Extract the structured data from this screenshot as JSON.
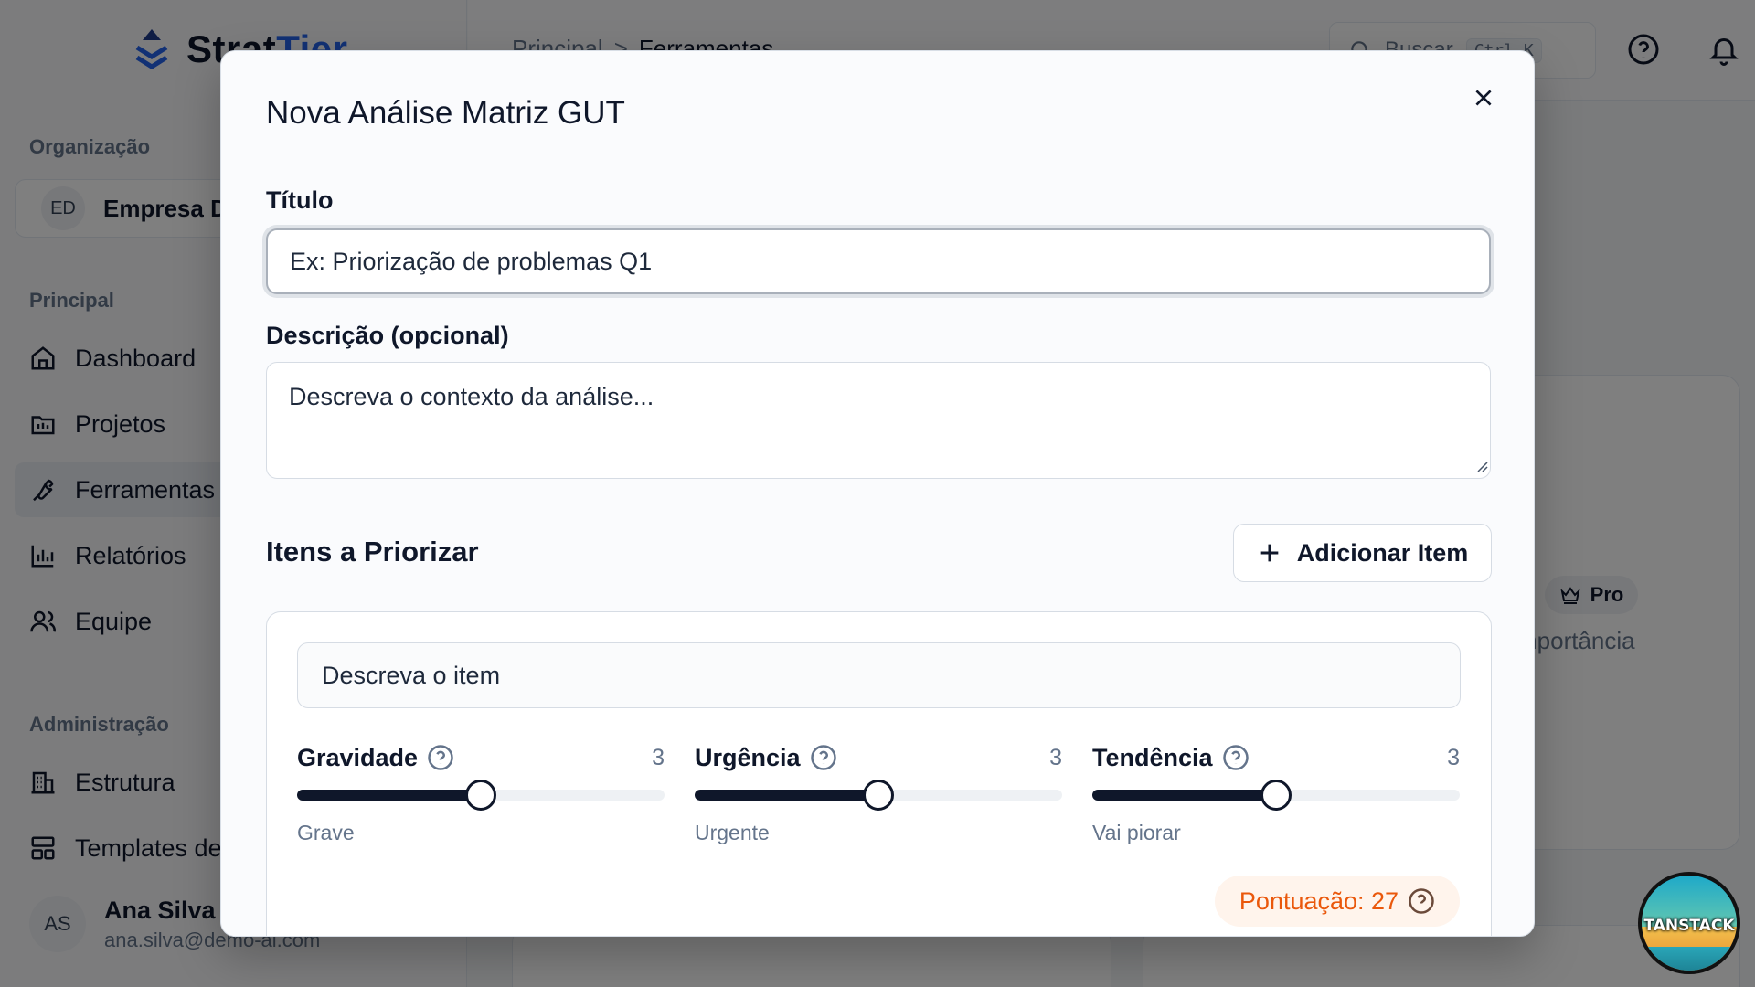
{
  "app": {
    "logo_text_a": "Strat",
    "logo_text_b": "Tier"
  },
  "sidebar": {
    "org_label": "Organização",
    "org_badge": "ED",
    "org_name": "Empresa D",
    "principal_label": "Principal",
    "admin_label": "Administração",
    "items": [
      {
        "label": "Dashboard",
        "icon": "home-icon"
      },
      {
        "label": "Projetos",
        "icon": "folder-icon"
      },
      {
        "label": "Ferramentas",
        "icon": "wrench-icon",
        "active": true
      },
      {
        "label": "Relatórios",
        "icon": "bar-chart-icon"
      },
      {
        "label": "Equipe",
        "icon": "users-icon"
      }
    ],
    "admin_items": [
      {
        "label": "Estrutura",
        "icon": "building-icon"
      },
      {
        "label": "Templates de",
        "icon": "layout-icon"
      }
    ],
    "user": {
      "initials": "AS",
      "name": "Ana Silva",
      "email": "ana.silva@demo-ai.com"
    }
  },
  "topbar": {
    "breadcrumb": [
      "Principal",
      ">",
      "Ferramentas"
    ],
    "search_placeholder": "Buscar",
    "shortcut": "Ctrl K"
  },
  "background": {
    "pro_badge": "Pro",
    "card_text": "mportância"
  },
  "modal": {
    "title": "Nova Análise Matriz GUT",
    "title_label": "Título",
    "title_placeholder": "Ex: Priorização de problemas Q1",
    "desc_label": "Descrição (opcional)",
    "desc_placeholder": "Descreva o contexto da análise...",
    "items_title": "Itens a Priorizar",
    "add_item_label": "Adicionar Item",
    "item": {
      "placeholder": "Descreva o item",
      "sliders": [
        {
          "label": "Gravidade",
          "value": 3,
          "fraction": 0.5,
          "caption": "Grave"
        },
        {
          "label": "Urgência",
          "value": 3,
          "fraction": 0.5,
          "caption": "Urgente"
        },
        {
          "label": "Tendência",
          "value": 3,
          "fraction": 0.5,
          "caption": "Vai piorar"
        }
      ],
      "score_label": "Pontuação: 27"
    }
  },
  "badge": {
    "text": "TANSTACK"
  }
}
